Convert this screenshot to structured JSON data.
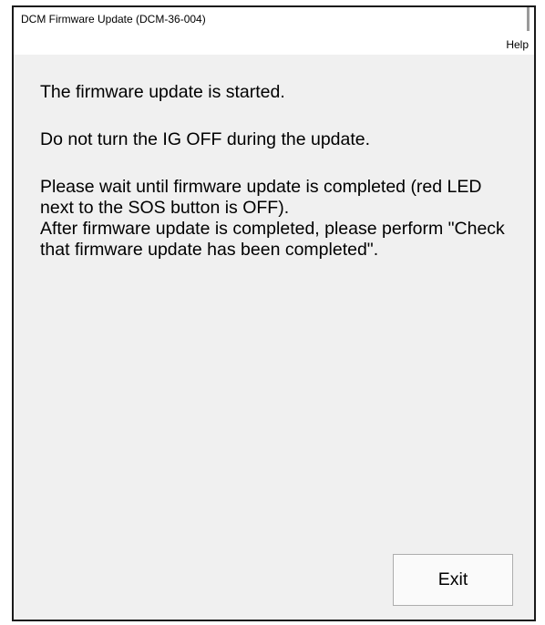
{
  "window": {
    "title": "DCM Firmware Update (DCM-36-004)"
  },
  "menu": {
    "help_label": "Help"
  },
  "messages": {
    "line1": "The firmware update is started.",
    "line2": "Do not turn the IG OFF during the update.",
    "line3": "Please wait until firmware update is completed (red LED next to the SOS button is OFF).\nAfter firmware update is completed, please perform \"Check that firmware update has been completed\"."
  },
  "buttons": {
    "exit_label": "Exit"
  }
}
